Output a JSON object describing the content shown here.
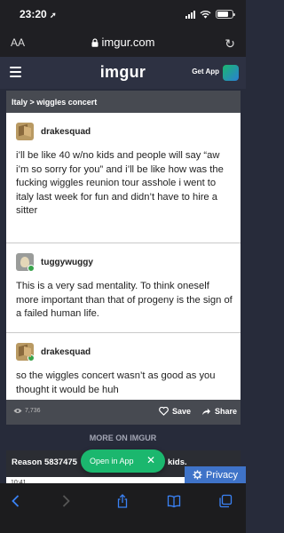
{
  "status_bar": {
    "time": "23:20",
    "location_glyph": "➚"
  },
  "browser": {
    "text_size_label": "AA",
    "url": "imgur.com",
    "reload_glyph": "↻"
  },
  "imgur_header": {
    "logo": "imgur",
    "get_app": "Get App"
  },
  "post": {
    "title": "Italy > wiggles concert",
    "entries": [
      {
        "username": "drakesquad",
        "text": "i’ll be like 40 w/no kids and people will say “aw i’m so sorry for you” and i’ll be like how was the fucking wiggles reunion tour asshole i went to italy last week for fun and didn’t have to hire a sitter"
      },
      {
        "username": "tuggywuggy",
        "text": "This is a very sad mentality. To think oneself more important than that of progeny is the sign of a failed human life."
      },
      {
        "username": "drakesquad",
        "text": "so the wiggles concert wasn’t as good as you thought it would be huh"
      }
    ],
    "views": "7,736",
    "save_label": "Save",
    "share_label": "Share"
  },
  "more_on": "MORE ON IMGUR",
  "next_post": {
    "title": "Reason 5837475",
    "title_end": "kids.",
    "strip_time": "10:41"
  },
  "open_in_app": {
    "label": "Open in App",
    "close_glyph": "✕"
  },
  "privacy": {
    "label": "Privacy"
  },
  "colors": {
    "imgur_green": "#1bb76e",
    "privacy_blue": "#3f73c8",
    "safari_blue": "#3a82f6",
    "page_bg": "#272b3a"
  }
}
